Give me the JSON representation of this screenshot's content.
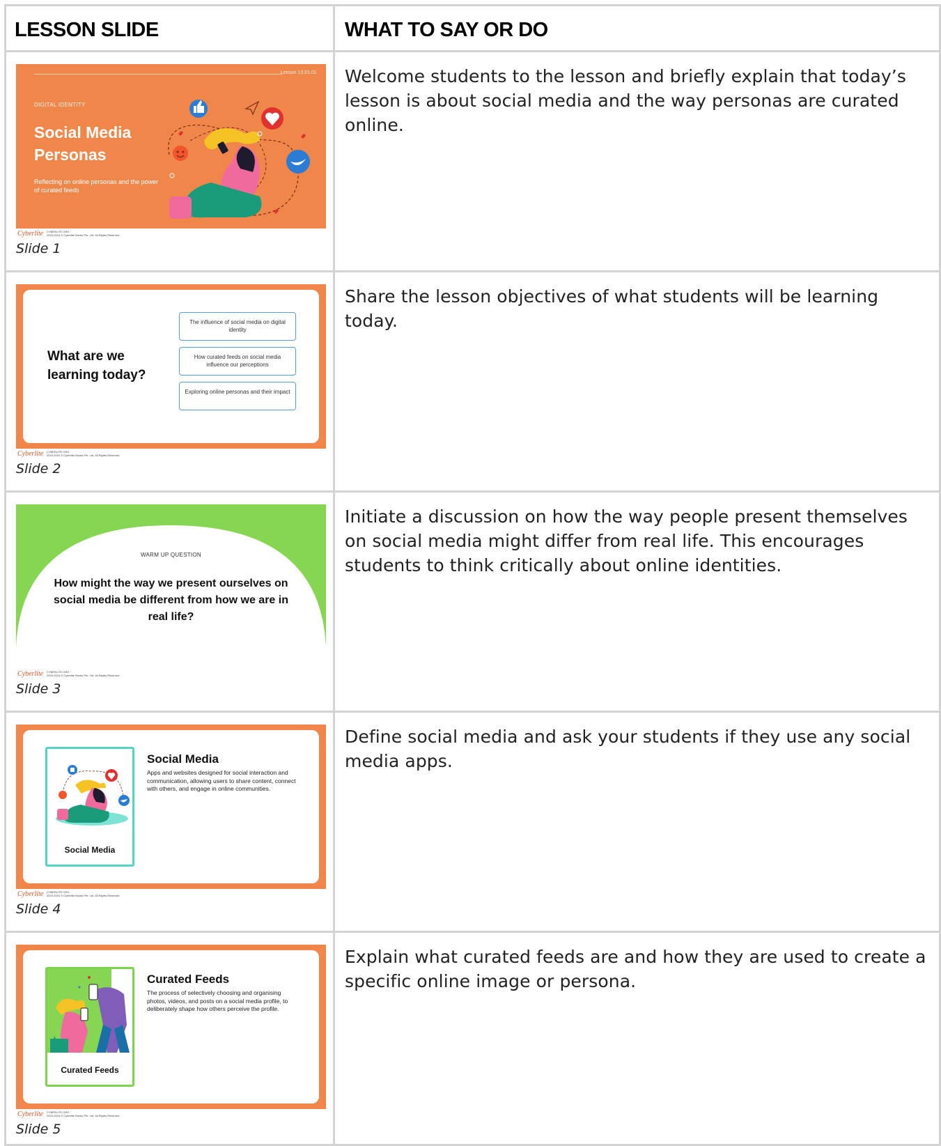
{
  "headers": {
    "slide": "LESSON SLIDE",
    "say": "WHAT TO SAY OR DO"
  },
  "footer": {
    "logo": "Cyberlite",
    "site": "CYBERLITE.ORG",
    "copyright": "2023-2024 © Cyberlite Books Pte. Ltd. All Rights Reserved."
  },
  "rows": [
    {
      "caption": "Slide 1",
      "say": "Welcome students to the lesson and briefly explain that today’s lesson is about social media and the way personas are curated online.",
      "slide": {
        "lesson_no": "Lesson 13.01.01",
        "kicker": "DIGITAL IDENTITY",
        "title": "Social Media Personas",
        "subtitle": "Reflecting on online personas and the power of curated feeds"
      }
    },
    {
      "caption": "Slide 2",
      "say": "Share the lesson objectives of what students will be learning today.",
      "slide": {
        "question": "What are we learning today?",
        "objectives": [
          "The influence of social media on digital identity",
          "How curated feeds on social media influence our perceptions",
          "Exploring online personas and their impact"
        ]
      }
    },
    {
      "caption": "Slide 3",
      "say": "Initiate a discussion on how the way people present themselves on social media might differ from real life. This encourages students to think critically about online identities.",
      "slide": {
        "kicker": "WARM UP QUESTION",
        "question": "How might the way we present ourselves on social media be different from how we are in real life?"
      }
    },
    {
      "caption": "Slide 4",
      "say": "Define social media and ask your students if they use any social media apps.",
      "slide": {
        "card_label": "Social Media",
        "title": "Social Media",
        "description": "Apps and websites designed for social interaction and communication, allowing users to share content, connect with others, and engage in online communities."
      }
    },
    {
      "caption": "Slide 5",
      "say": "Explain what curated feeds are and how they are used to create a specific online image or persona.",
      "slide": {
        "card_label": "Curated Feeds",
        "title": "Curated Feeds",
        "description": "The process of selectively choosing and organising photos, videos, and posts on a social media profile, to deliberately shape how others perceive the profile."
      }
    }
  ],
  "colors": {
    "orange": "#ef874b",
    "green": "#86d654",
    "teal": "#55d4c4",
    "pink": "#f06a9b",
    "blue": "#2b7cd3",
    "red": "#e0302f"
  },
  "icons": [
    "thumbs-up-icon",
    "heart-icon",
    "bird-icon",
    "smiley-icon",
    "cursor-icon"
  ]
}
